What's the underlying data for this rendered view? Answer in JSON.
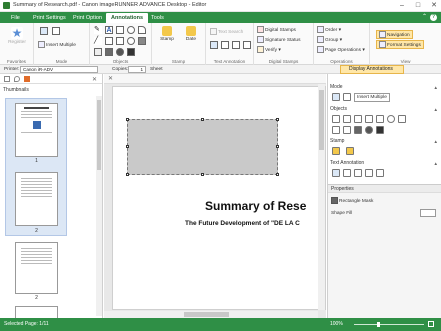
{
  "window": {
    "title": "Summary of Research.pdf - Canon imageRUNNER ADVANCE Desktop - Editor",
    "controls": [
      "–",
      "□",
      "✕"
    ]
  },
  "tabs": [
    {
      "label": "File",
      "active": false
    },
    {
      "label": "Print Settings",
      "active": false
    },
    {
      "label": "Print Option",
      "active": false
    },
    {
      "label": "Annotations",
      "active": true
    },
    {
      "label": "Tools",
      "active": false
    }
  ],
  "help_label": "?",
  "ribbon": {
    "favorites": {
      "register_label": "Register",
      "group_label": "Favorites"
    },
    "mode": {
      "insert_multiple_label": "Insert Multiple",
      "group_label": "Mode"
    },
    "objects": {
      "group_label": "Objects"
    },
    "stamp": {
      "stamp_label": "Stamp",
      "date_label": "Date",
      "group_label": "Stamp"
    },
    "text_annotation": {
      "text_search_label": "Text Search",
      "group_label": "Text Annotation"
    },
    "digital_stamps": {
      "digital_stamps_label": "Digital Stamps",
      "signature_status_label": "Signature Status",
      "verify_label": "Verify",
      "group_label": "Digital Stamps"
    },
    "operations": {
      "order_label": "Order",
      "group_label_btn": "Group",
      "page_operations_label": "Page Operations",
      "group_label": "Operations"
    },
    "view": {
      "navigation_label": "Navigation",
      "format_settings_label": "Format Settings",
      "group_label": "View"
    }
  },
  "toolbar2": {
    "printer_label": "Printer:",
    "printer_value": "Canon iR-ADV",
    "copies_label": "Copies:",
    "copies_value": "1",
    "sheet_label": "Sheet",
    "display_annotations_label": "Display Annotations"
  },
  "left_pane": {
    "thumbnails_label": "Thumbnails",
    "pages": [
      "1",
      "2",
      "2",
      "3"
    ],
    "first_thumb_title": "Summary of Research"
  },
  "document": {
    "title": "Summary of Rese",
    "subtitle": "The Future Development of \"DE LA C"
  },
  "right_pane": {
    "mode_label": "Mode",
    "insert_multiple_label": "Insert Multiple",
    "objects_label": "Objects",
    "stamp_label": "Stamp",
    "text_annotation_label": "Text Annotation",
    "properties_label": "Properties",
    "rectangle_mask_label": "Rectangle Mask",
    "shape_fill_label": "Shape Fill"
  },
  "statusbar": {
    "selected_page": "Selected Page: 1/11",
    "zoom": "100%",
    "zoom_fraction": 0.35
  },
  "colors": {
    "brand_green": "#2f8f46",
    "highlight": "#ffe7a8",
    "mask_gray": "#c9c9c9"
  }
}
